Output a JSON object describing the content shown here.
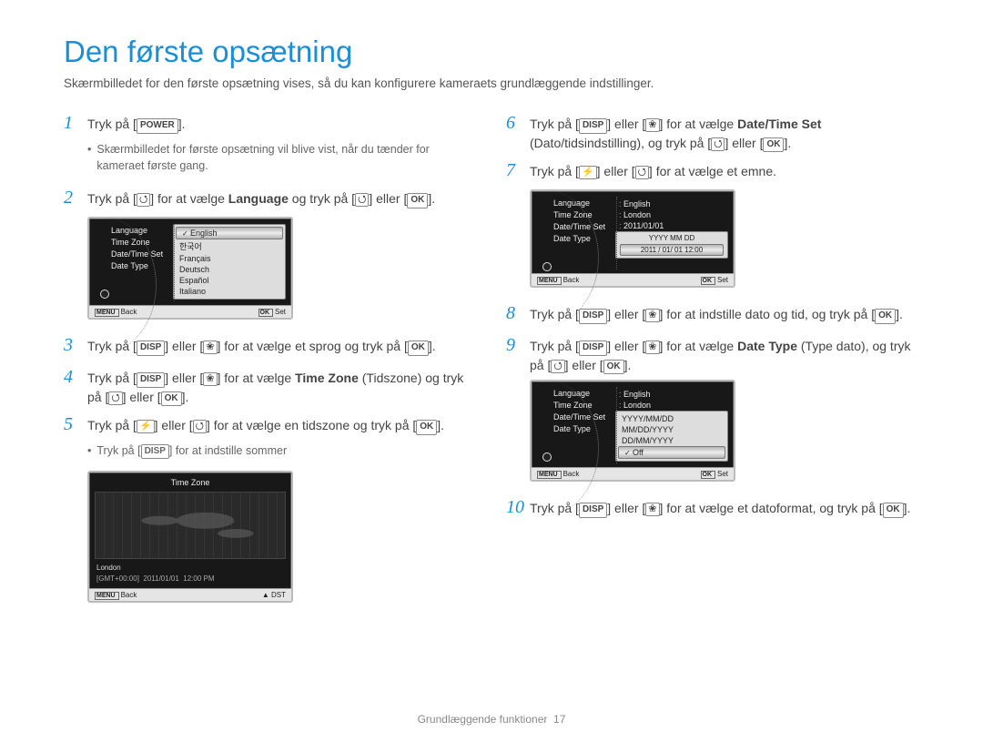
{
  "title": "Den første opsætning",
  "intro": "Skærmbilledet for den første opsætning vises, så du kan konfigurere kameraets grundlæggende indstillinger.",
  "keys": {
    "power": "POWER",
    "ok": "OK",
    "disp": "DISP",
    "macro": "❀",
    "timer": "⭯",
    "flash": "⚡"
  },
  "left": {
    "s1": "Tryk på [",
    "s1b": "].",
    "s1_bullet": "Skærmbilledet for første opsætning vil blive vist, når du tænder for kameraet første gang.",
    "s2a": "Tryk på [",
    "s2b": "] for at vælge ",
    "s2c": "Language",
    "s2d": " og tryk på [",
    "s2e": "] eller [",
    "s2f": "].",
    "s3a": "Tryk på [",
    "s3b": "] eller [",
    "s3c": "] for at vælge et sprog og tryk på [",
    "s3d": "].",
    "s4a": "Tryk på [",
    "s4b": "] eller [",
    "s4c": "] for at vælge ",
    "s4d": "Time Zone",
    "s4e": " (Tidszone) og tryk på [",
    "s4f": "] eller [",
    "s4g": "].",
    "s5a": "Tryk på [",
    "s5b": "] eller [",
    "s5c": "] for at vælge en tidszone og tryk på [",
    "s5d": "].",
    "s5_bullet": "Tryk på [",
    "s5_bullet_b": "] for at indstille sommer"
  },
  "right": {
    "s6a": "Tryk på [",
    "s6b": "] eller [",
    "s6c": "] for at vælge ",
    "s6d": "Date/Time Set",
    "s6e": " (Dato/tidsindstilling), og tryk på [",
    "s6f": "] eller [",
    "s6g": "].",
    "s7a": "Tryk på [",
    "s7b": "] eller [",
    "s7c": "] for at vælge et emne.",
    "s8a": "Tryk på [",
    "s8b": "] eller [",
    "s8c": "] for at indstille dato og tid, og tryk på [",
    "s8d": "].",
    "s9a": "Tryk på [",
    "s9b": "] eller [",
    "s9c": "] for at vælge ",
    "s9d": "Date Type",
    "s9e": " (Type dato), og tryk på [",
    "s9f": "] eller [",
    "s9g": "].",
    "s10a": "Tryk på [",
    "s10b": "] eller [",
    "s10c": "] for at vælge et datoformat, og tryk på [",
    "s10d": "]."
  },
  "cam1": {
    "menu": [
      "Language",
      "Time Zone",
      "Date/Time Set",
      "Date Type"
    ],
    "langs": [
      "English",
      "한국어",
      "Français",
      "Deutsch",
      "Español",
      "Italiano"
    ],
    "back": "Back",
    "set": "Set"
  },
  "cam_tz": {
    "title": "Time Zone",
    "city": "London",
    "gmt": "[GMT+00:00]",
    "date": "2011/01/01",
    "time": "12:00 PM",
    "back": "Back",
    "dst": "DST"
  },
  "cam2": {
    "rows": [
      {
        "k": "Language",
        "v": "English"
      },
      {
        "k": "Time Zone",
        "v": "London"
      },
      {
        "k": "Date/Time Set",
        "v": "2011/01/01"
      },
      {
        "k": "Date Type",
        "v": ""
      }
    ],
    "hdr": "YYYY MM DD",
    "dateline": "2011 / 01/ 01  12:00",
    "back": "Back",
    "set": "Set"
  },
  "cam3": {
    "rows": [
      {
        "k": "Language",
        "v": "English"
      },
      {
        "k": "Time Zone",
        "v": "London"
      },
      {
        "k": "Date/Time Set",
        "v": ""
      },
      {
        "k": "Date Type",
        "v": ""
      }
    ],
    "opts": [
      "YYYY/MM/DD",
      "MM/DD/YYYY",
      "DD/MM/YYYY",
      "Off"
    ],
    "back": "Back",
    "set": "Set"
  },
  "footer": {
    "label": "Grundlæggende funktioner",
    "page": "17"
  }
}
